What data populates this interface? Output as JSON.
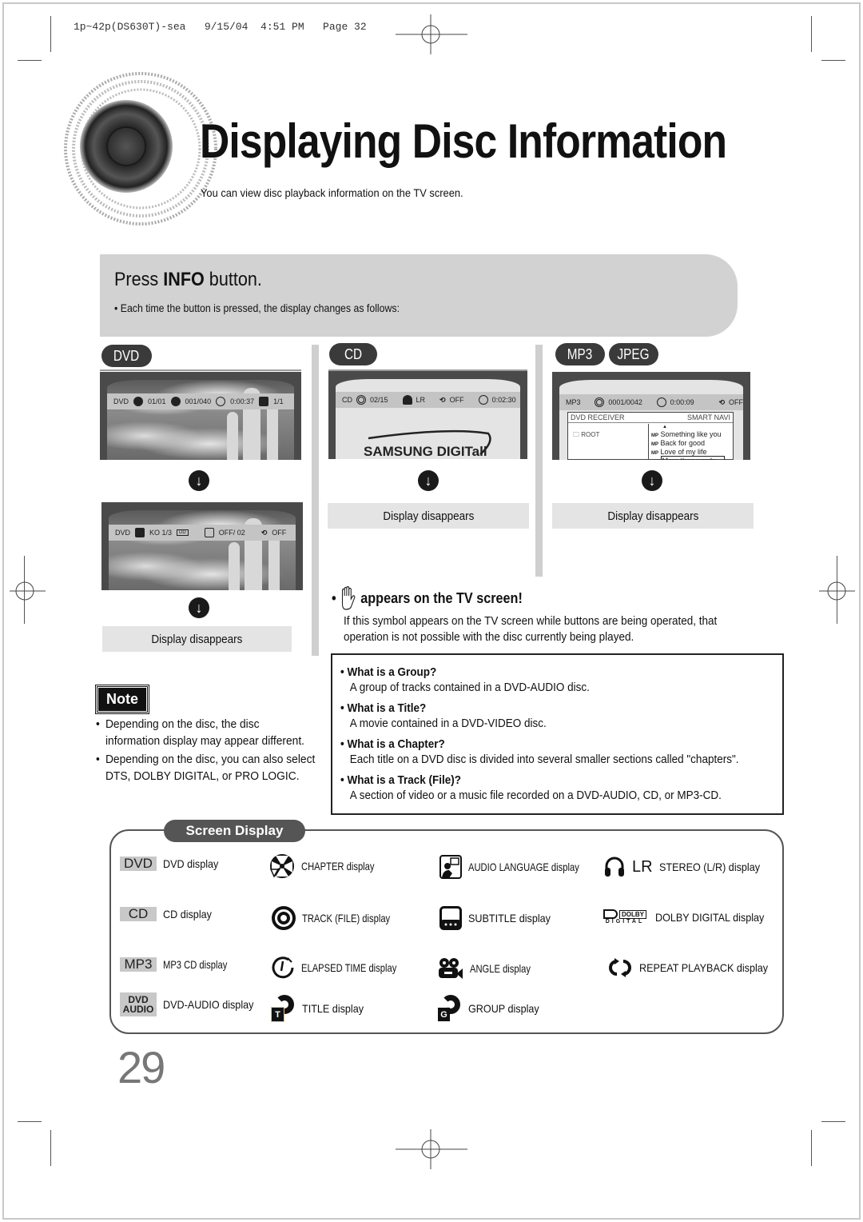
{
  "print_header": "1p~42p(DS630T)-sea   9/15/04  4:51 PM   Page 32",
  "title": "Displaying Disc Information",
  "subtitle": "You can view disc playback information  on the TV screen.",
  "step": {
    "prefix": "Press ",
    "bold": "INFO",
    "suffix": " button.",
    "bullet": "• Each time the button is pressed, the display changes as follows:"
  },
  "columns": {
    "dvd": {
      "tag": "DVD",
      "screen1": {
        "disc": "DVD",
        "title": "01/01",
        "chapter": "001/040",
        "time": "0:00:37",
        "angle": "1/1"
      },
      "screen2": {
        "disc": "DVD",
        "audio": "KO 1/3",
        "subtitle": "OFF/  02",
        "repeat": "OFF"
      },
      "result": "Display disappears"
    },
    "cd": {
      "tag": "CD",
      "screen": {
        "disc": "CD",
        "track": "02/15",
        "stereo": "LR",
        "repeat": "OFF",
        "time": "0:02:30",
        "brand": "SAMSUNG DIGITall"
      },
      "result": "Display disappears"
    },
    "mp3": {
      "tags": [
        "MP3",
        "JPEG"
      ],
      "screen": {
        "disc": "MP3",
        "track": "0001/0042",
        "time": "0:00:09",
        "repeat": "OFF",
        "header_left": "DVD RECEIVER",
        "header_right": "SMART NAVI",
        "folder": "ROOT",
        "files": [
          "Something like you",
          "Back for good",
          "Love of my life",
          "More than words"
        ],
        "selected_file": "More than words"
      },
      "result": "Display disappears"
    }
  },
  "hand_notice": {
    "heading": "appears on the TV screen!",
    "body": "If this symbol appears on the TV screen while buttons are being operated, that operation is not possible with the disc currently being played."
  },
  "faq": [
    {
      "q": "What is a Group?",
      "a": "A group of tracks contained in a DVD-AUDIO disc."
    },
    {
      "q": "What is a Title?",
      "a": "A movie contained in a DVD-VIDEO disc."
    },
    {
      "q": "What is a Chapter?",
      "a": "Each title on a DVD disc is divided into several smaller sections called \"chapters\"."
    },
    {
      "q": "What is a Track (File)?",
      "a": "A section of video or a music file recorded on a DVD-AUDIO, CD, or MP3-CD."
    }
  ],
  "note": {
    "badge": "Note",
    "items": [
      "Depending on the disc, the disc information display may appear different.",
      "Depending on the disc, you can also select DTS, DOLBY DIGITAL, or PRO LOGIC."
    ]
  },
  "screen_display": {
    "heading": "Screen Display",
    "items": [
      {
        "icon": "dvd-tag",
        "tag": "DVD",
        "label": "DVD display"
      },
      {
        "icon": "chapter-icon",
        "label": "CHAPTER display"
      },
      {
        "icon": "audio-language-icon",
        "label": "AUDIO LANGUAGE display"
      },
      {
        "icon": "stereo-headphones-icon",
        "tag": "LR",
        "label": "STEREO (L/R) display"
      },
      {
        "icon": "cd-tag",
        "tag": "CD",
        "label": "CD display"
      },
      {
        "icon": "track-icon",
        "label": "TRACK (FILE) display"
      },
      {
        "icon": "subtitle-icon",
        "label": "SUBTITLE display"
      },
      {
        "icon": "dolby-digital-icon",
        "tag": "DOLBY",
        "tag2": "DIGITAL",
        "label": "DOLBY DIGITAL display"
      },
      {
        "icon": "mp3-tag",
        "tag": "MP3",
        "label": "MP3 CD display"
      },
      {
        "icon": "elapsed-time-icon",
        "label": "ELAPSED TIME display"
      },
      {
        "icon": "angle-icon",
        "label": "ANGLE display"
      },
      {
        "icon": "repeat-icon",
        "label": "REPEAT PLAYBACK display"
      },
      {
        "icon": "dvd-audio-tag",
        "tag": "DVD",
        "tag2": "AUDIO",
        "label": "DVD-AUDIO display"
      },
      {
        "icon": "title-icon",
        "badge": "T",
        "label": "TITLE display"
      },
      {
        "icon": "group-icon",
        "badge": "G",
        "label": "GROUP display"
      }
    ]
  },
  "page_number": "29",
  "colors": {
    "panel_gray": "#d2d2d2",
    "pill_dark": "#3a3a3a",
    "light_gray": "#e4e4e4",
    "page_number": "#777777"
  }
}
